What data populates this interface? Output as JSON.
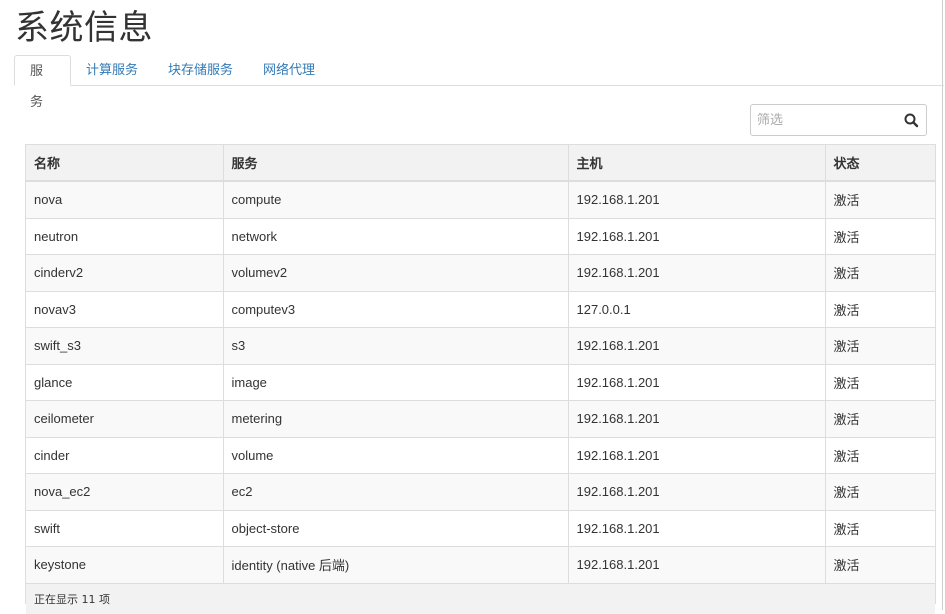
{
  "page": {
    "title": "系统信息"
  },
  "tabs": [
    {
      "label": "服务",
      "active": true
    },
    {
      "label": "计算服务",
      "active": false
    },
    {
      "label": "块存储服务",
      "active": false
    },
    {
      "label": "网络代理",
      "active": false
    }
  ],
  "filter": {
    "placeholder": "筛选",
    "icon": "search-icon"
  },
  "table": {
    "columns": [
      "名称",
      "服务",
      "主机",
      "状态"
    ],
    "rows": [
      [
        "nova",
        "compute",
        "192.168.1.201",
        "激活"
      ],
      [
        "neutron",
        "network",
        "192.168.1.201",
        "激活"
      ],
      [
        "cinderv2",
        "volumev2",
        "192.168.1.201",
        "激活"
      ],
      [
        "novav3",
        "computev3",
        "127.0.0.1",
        "激活"
      ],
      [
        "swift_s3",
        "s3",
        "192.168.1.201",
        "激活"
      ],
      [
        "glance",
        "image",
        "192.168.1.201",
        "激活"
      ],
      [
        "ceilometer",
        "metering",
        "192.168.1.201",
        "激活"
      ],
      [
        "cinder",
        "volume",
        "192.168.1.201",
        "激活"
      ],
      [
        "nova_ec2",
        "ec2",
        "192.168.1.201",
        "激活"
      ],
      [
        "swift",
        "object-store",
        "192.168.1.201",
        "激活"
      ],
      [
        "keystone",
        "identity (native 后端)",
        "192.168.1.201",
        "激活"
      ]
    ],
    "footer": "正在显示 11 项"
  },
  "colors": {
    "link": "#337ab7",
    "border": "#dddddd",
    "header_bg": "#f2f2f2",
    "stripe": "#f9f9f9"
  }
}
